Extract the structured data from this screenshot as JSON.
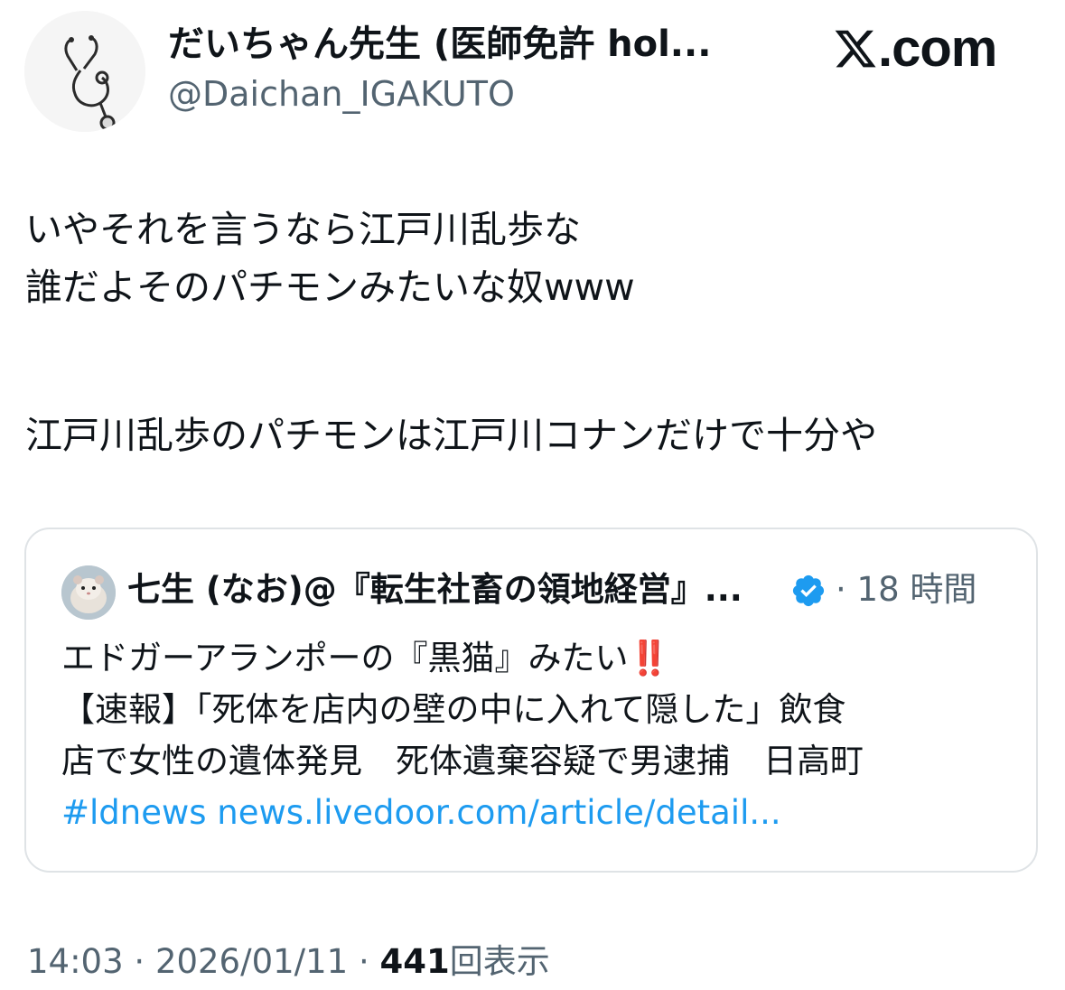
{
  "author": {
    "display_name": "だいちゃん先生 (医師免許 hol...",
    "handle": "@Daichan_IGAKUTO",
    "avatar_icon": "stethoscope-icon"
  },
  "brand": {
    "logo_icon": "x-logo-icon",
    "logo_text": ".com"
  },
  "tweet": {
    "lines": [
      "いやそれを言うなら江戸川乱歩な",
      "誰だよそのパチモンみたいな奴www",
      "江戸川乱歩のパチモンは江戸川コナンだけで十分や"
    ]
  },
  "quote": {
    "author_name": "七生 (なお)@『転生社畜の領地経営』...",
    "verified_icon": "verified-badge-icon",
    "time": "· 18 時間",
    "line1": "エドガーアランポーの『黒猫』みたい",
    "line1_emoji": "‼️",
    "line2": "【速報】「死体を店内の壁の中に入れて隠した」飲食",
    "line3": "店で女性の遺体発見　死体遺棄容疑で男逮捕　日高町",
    "link_text": "#ldnews news.livedoor.com/article/detail..."
  },
  "meta": {
    "time": "14:03",
    "date": "2026/01/11",
    "separator": "·",
    "views_count": "441",
    "views_label": "回表示"
  },
  "colors": {
    "text": "#0f1419",
    "secondary": "#536471",
    "link": "#1d9bf0",
    "border": "#dfe3e6"
  }
}
